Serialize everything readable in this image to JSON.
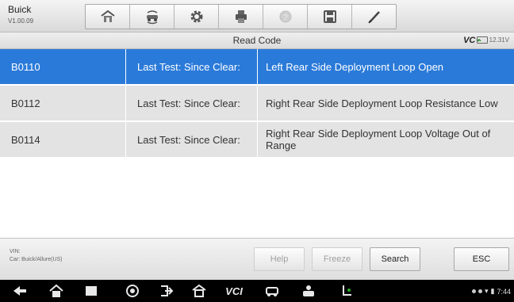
{
  "app": {
    "name": "Buick",
    "version": "V1.00.09"
  },
  "toolbar": {
    "buttons": [
      {
        "icon": "home-icon"
      },
      {
        "icon": "vehicle-swap-icon"
      },
      {
        "icon": "gear-icon"
      },
      {
        "icon": "print-icon"
      },
      {
        "icon": "help-icon"
      },
      {
        "icon": "save-icon"
      },
      {
        "icon": "pen-icon"
      }
    ]
  },
  "subbar": {
    "title": "Read Code",
    "vci": "VC",
    "battery": "12.31V"
  },
  "codes": [
    {
      "code": "B0110",
      "status": "Last Test: Since Clear:",
      "description": "Left Rear Side Deployment Loop Open",
      "selected": true
    },
    {
      "code": "B0112",
      "status": "Last Test: Since Clear:",
      "description": "Right Rear Side Deployment Loop Resistance Low",
      "selected": false
    },
    {
      "code": "B0114",
      "status": "Last Test: Since Clear:",
      "description": "Right Rear Side Deployment Loop Voltage Out of Range",
      "selected": false
    }
  ],
  "footer": {
    "vin_label": "VIN:",
    "car": "Car: Buick/Allure(US)",
    "help": "Help",
    "freeze": "Freeze",
    "search": "Search",
    "esc": "ESC"
  },
  "navbar": {
    "vcl": "VCI",
    "time": "7:44"
  },
  "colors": {
    "selected_row": "#2a7ad9",
    "row": "#e3e3e3"
  }
}
